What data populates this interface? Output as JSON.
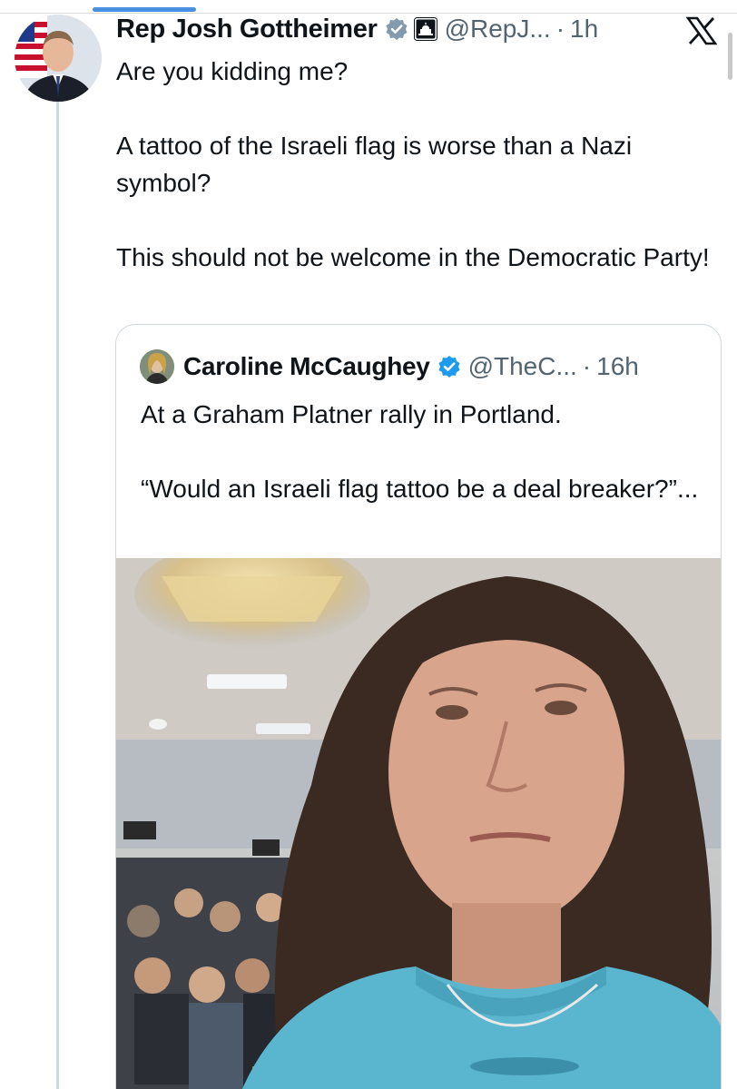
{
  "tweet": {
    "display_name": "Rep Josh Gottheimer",
    "handle": "@RepJ...",
    "separator": "·",
    "time": "1h",
    "paragraphs": [
      "Are you kidding me?",
      "A tattoo of the Israeli flag is worse than a Nazi symbol?",
      "This should not be welcome in the Democratic Party!"
    ]
  },
  "quote": {
    "display_name": "Caroline McCaughey",
    "handle": "@TheC...",
    "separator": "·",
    "time": "16h",
    "paragraphs": [
      "At a Graham Platner rally in Portland.",
      "“Would an Israeli flag tattoo be a deal breaker?”..."
    ]
  },
  "icons": {
    "verified": "verified-badge-icon",
    "government": "government-capitol-badge-icon",
    "close": "x-logo-icon"
  },
  "colors": {
    "verified_blue": "#1d9bf0",
    "secondary_text": "#536471",
    "border": "#cfd9de",
    "accent_indicator": "#4a90e2"
  }
}
